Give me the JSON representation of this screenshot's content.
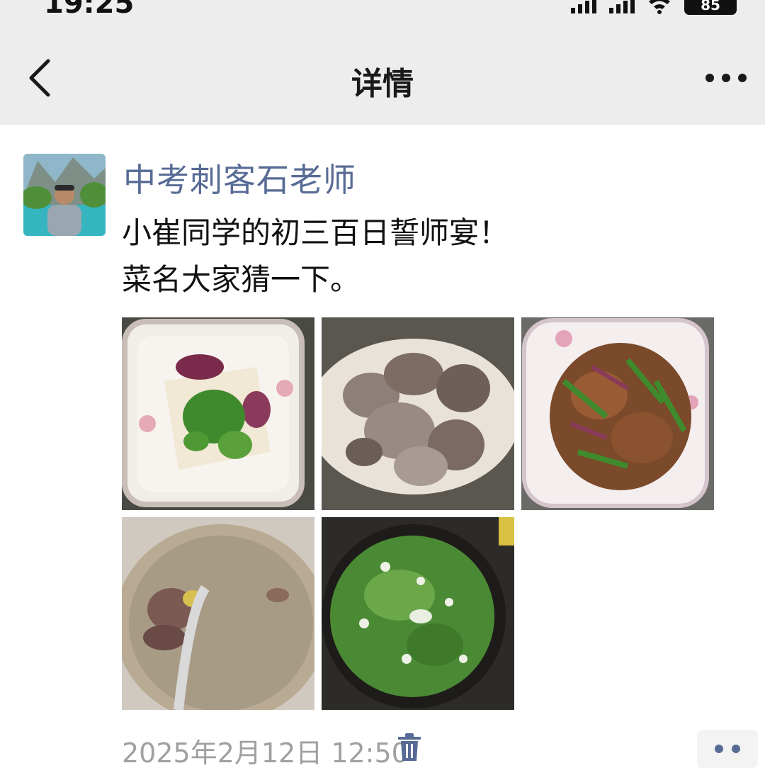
{
  "status_bar": {
    "time": "19:25",
    "battery": "85"
  },
  "header": {
    "title": "详情"
  },
  "post": {
    "author": "中考刺客石老师",
    "text_lines": [
      "小崔同学的初三百日誓师宴！",
      "菜名大家猜一下。"
    ],
    "photos": [
      {
        "name": "photo-tofu-salad"
      },
      {
        "name": "photo-boiled-meat"
      },
      {
        "name": "photo-stir-fry"
      },
      {
        "name": "photo-soup"
      },
      {
        "name": "photo-herb-soup"
      }
    ],
    "timestamp": "2025年2月12日 12:50"
  },
  "colors": {
    "author": "#576b95",
    "header_bg": "#ededed",
    "meta": "#a0a0a0"
  },
  "icons": [
    "chevron-left-icon",
    "more-icon",
    "trash-icon",
    "comment-icon"
  ]
}
